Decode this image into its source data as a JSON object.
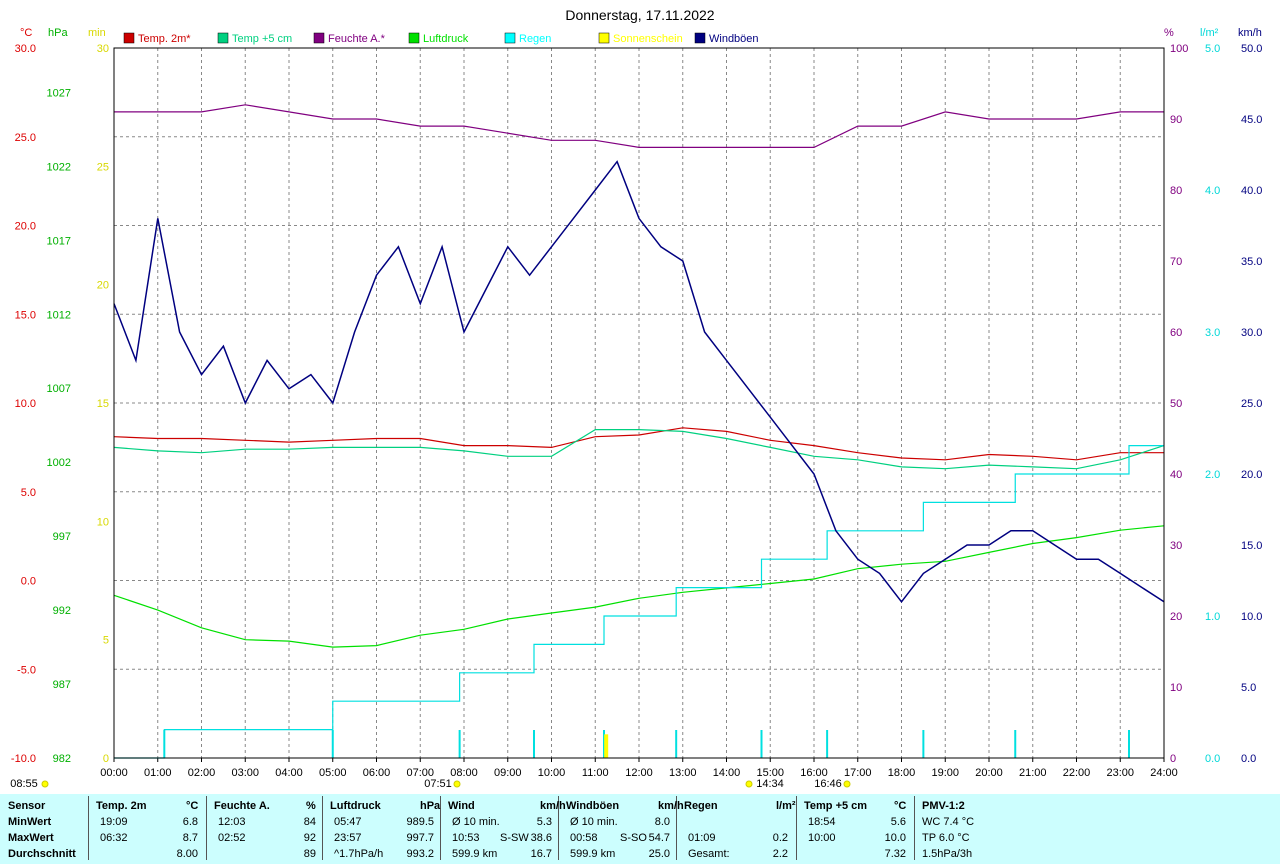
{
  "chart_data": {
    "type": "line",
    "title": "Donnerstag, 17.11.2022",
    "x_ticks": [
      "00:00",
      "01:00",
      "02:00",
      "03:00",
      "04:00",
      "05:00",
      "06:00",
      "07:00",
      "08:00",
      "09:00",
      "10:00",
      "11:00",
      "12:00",
      "13:00",
      "14:00",
      "15:00",
      "16:00",
      "17:00",
      "18:00",
      "19:00",
      "20:00",
      "21:00",
      "22:00",
      "23:00",
      "24:00"
    ],
    "sun_labels": {
      "sunrise": "07:51",
      "solar_noon": "14:34",
      "sunset": "16:46",
      "time_left": "08:55"
    },
    "axes": {
      "temp": {
        "unit": "°C",
        "range": [
          -10,
          30
        ],
        "ticks": [
          "30.0",
          "25.0",
          "20.0",
          "15.0",
          "10.0",
          "5.0",
          "0.0",
          "-5.0",
          "-10.0"
        ],
        "color": "#ff0000"
      },
      "pressure": {
        "unit": "hPa",
        "range": [
          982,
          1030
        ],
        "ticks": [
          "1027",
          "1022",
          "1017",
          "1012",
          "1007",
          "1002",
          "997",
          "992",
          "987",
          "982"
        ],
        "color": "#00c000"
      },
      "sunshine": {
        "unit": "min",
        "range": [
          0,
          30
        ],
        "ticks": [
          "30",
          "25",
          "20",
          "15",
          "10",
          "5",
          "0"
        ],
        "color": "#ffff00"
      },
      "humidity": {
        "unit": "%",
        "range": [
          0,
          100
        ],
        "ticks": [
          "100",
          "90",
          "80",
          "70",
          "60",
          "50",
          "40",
          "30",
          "20",
          "10",
          "0"
        ],
        "color": "#800080"
      },
      "rain": {
        "unit": "l/m²",
        "range": [
          0,
          5
        ],
        "ticks": [
          "5.0",
          "4.0",
          "3.0",
          "2.0",
          "1.0",
          "0.0"
        ],
        "color": "#00ffff"
      },
      "wind": {
        "unit": "km/h",
        "range": [
          0,
          50
        ],
        "ticks": [
          "50.0",
          "45.0",
          "40.0",
          "35.0",
          "30.0",
          "25.0",
          "20.0",
          "15.0",
          "10.0",
          "5.0",
          "0.0"
        ],
        "color": "#000080"
      }
    },
    "legend": [
      {
        "name": "Temp. 2m*",
        "color": "#cc0000"
      },
      {
        "name": "Temp +5 cm",
        "color": "#00d080"
      },
      {
        "name": "Feuchte A.*",
        "color": "#800080"
      },
      {
        "name": "Luftdruck",
        "color": "#00e000"
      },
      {
        "name": "Regen",
        "color": "#00ffff"
      },
      {
        "name": "Sonnenschein",
        "color": "#ffff00"
      },
      {
        "name": "Windböen",
        "color": "#000080"
      }
    ],
    "series": [
      {
        "name": "Temp. 2m*",
        "axis": "temp",
        "x": [
          0,
          1,
          2,
          3,
          4,
          5,
          6,
          7,
          8,
          9,
          10,
          11,
          12,
          13,
          14,
          15,
          16,
          17,
          18,
          19,
          20,
          21,
          22,
          23,
          24
        ],
        "y": [
          8.1,
          8.0,
          8.0,
          7.9,
          7.8,
          7.9,
          8.0,
          8.0,
          7.6,
          7.6,
          7.5,
          8.1,
          8.2,
          8.6,
          8.4,
          7.9,
          7.6,
          7.2,
          6.9,
          6.8,
          7.1,
          7.0,
          6.8,
          7.2,
          7.2
        ]
      },
      {
        "name": "Temp +5 cm",
        "axis": "temp",
        "x": [
          0,
          1,
          2,
          3,
          4,
          5,
          6,
          7,
          8,
          9,
          10,
          11,
          12,
          13,
          14,
          15,
          16,
          17,
          18,
          19,
          20,
          21,
          22,
          23,
          24
        ],
        "y": [
          7.5,
          7.3,
          7.2,
          7.4,
          7.4,
          7.5,
          7.5,
          7.5,
          7.3,
          7.0,
          7.0,
          8.5,
          8.5,
          8.4,
          8.0,
          7.5,
          7.0,
          6.8,
          6.4,
          6.3,
          6.5,
          6.4,
          6.3,
          6.8,
          7.6
        ]
      },
      {
        "name": "Feuchte A.*",
        "axis": "humidity",
        "x": [
          0,
          1,
          2,
          3,
          4,
          5,
          6,
          7,
          8,
          9,
          10,
          11,
          12,
          13,
          14,
          15,
          16,
          17,
          18,
          19,
          20,
          21,
          22,
          23,
          24
        ],
        "y": [
          91,
          91,
          91,
          92,
          91,
          90,
          90,
          89,
          89,
          88,
          87,
          87,
          86,
          86,
          86,
          86,
          86,
          89,
          89,
          91,
          90,
          90,
          90,
          91,
          91
        ]
      },
      {
        "name": "Luftdruck",
        "axis": "pressure",
        "x": [
          0,
          1,
          2,
          3,
          4,
          5,
          6,
          7,
          8,
          9,
          10,
          11,
          12,
          13,
          14,
          15,
          16,
          17,
          18,
          19,
          20,
          21,
          22,
          23,
          24
        ],
        "y": [
          993.0,
          992.0,
          990.8,
          990.0,
          989.9,
          989.5,
          989.6,
          990.3,
          990.7,
          991.4,
          991.8,
          992.2,
          992.8,
          993.2,
          993.5,
          993.8,
          994.1,
          994.8,
          995.1,
          995.3,
          995.9,
          996.5,
          996.9,
          997.4,
          997.7
        ]
      },
      {
        "name": "Regen",
        "axis": "rain",
        "type": "step",
        "x": [
          0,
          1.15,
          5.0,
          7.9,
          9.6,
          11.2,
          12.85,
          14.8,
          16.3,
          18.5,
          20.6,
          23.2,
          24
        ],
        "y": [
          0.0,
          0.2,
          0.4,
          0.6,
          0.8,
          1.0,
          1.2,
          1.4,
          1.6,
          1.8,
          2.0,
          2.2,
          2.2
        ]
      },
      {
        "name": "Windböen",
        "axis": "wind",
        "x": [
          0,
          0.5,
          1,
          1.5,
          2,
          2.5,
          3,
          3.5,
          4,
          4.5,
          5,
          5.5,
          6,
          6.5,
          7,
          7.5,
          8,
          8.5,
          9,
          9.5,
          10,
          10.5,
          11,
          11.5,
          12,
          12.5,
          13,
          13.5,
          14,
          14.5,
          15,
          15.5,
          16,
          16.5,
          17,
          17.5,
          18,
          18.5,
          19,
          19.5,
          20,
          20.5,
          21,
          21.5,
          22,
          22.5,
          23,
          23.5,
          24
        ],
        "y": [
          32,
          28,
          38,
          30,
          27,
          29,
          25,
          28,
          26,
          27,
          25,
          30,
          34,
          36,
          32,
          36,
          30,
          33,
          36,
          34,
          36,
          38,
          40,
          42,
          38,
          36,
          35,
          30,
          28,
          26,
          24,
          22,
          20,
          16,
          14,
          13,
          11,
          13,
          14,
          15,
          15,
          16,
          16,
          15,
          14,
          14,
          13,
          12,
          11
        ]
      }
    ],
    "sunshine_bars": [
      {
        "time": 11.25,
        "min": 1.0
      }
    ]
  },
  "stats": {
    "headers": [
      {
        "label": "Sensor",
        "unit": ""
      },
      {
        "label": "Temp. 2m",
        "unit": "°C"
      },
      {
        "label": "Feuchte A.",
        "unit": "%"
      },
      {
        "label": "Luftdruck",
        "unit": "hPa"
      },
      {
        "label": "Wind",
        "unit": "km/h"
      },
      {
        "label": "Windböen",
        "unit": "km/h"
      },
      {
        "label": "Regen",
        "unit": "l/m²"
      },
      {
        "label": "Temp +5 cm",
        "unit": "°C"
      },
      {
        "label": "PMV-1:2",
        "unit": ""
      }
    ],
    "row_labels": [
      "MinWert",
      "MaxWert",
      "Durchschnitt"
    ],
    "temp2m": [
      [
        "19:09",
        "6.8"
      ],
      [
        "06:32",
        "8.7"
      ],
      [
        "",
        "8.00"
      ]
    ],
    "feuchte": [
      [
        "12:03",
        "84"
      ],
      [
        "02:52",
        "92"
      ],
      [
        "",
        "89"
      ]
    ],
    "luftdruck": [
      [
        "05:47",
        "989.5"
      ],
      [
        "23:57",
        "997.7"
      ],
      [
        "^1.7hPa/h",
        "993.2"
      ]
    ],
    "wind": [
      [
        "Ø 10 min.",
        "",
        "5.3"
      ],
      [
        "10:53",
        "S-SW",
        "38.6"
      ],
      [
        "599.9 km",
        "",
        "16.7"
      ]
    ],
    "boeen": [
      [
        "Ø 10 min.",
        "",
        "8.0"
      ],
      [
        "00:58",
        "S-SO",
        "54.7"
      ],
      [
        "599.9 km",
        "",
        "25.0"
      ]
    ],
    "regen": [
      [
        "",
        ""
      ],
      [
        "01:09",
        "0.2"
      ],
      [
        "Gesamt:",
        "2.2"
      ]
    ],
    "temp5": [
      [
        "18:54",
        "5.6"
      ],
      [
        "10:00",
        "10.0"
      ],
      [
        "",
        "7.32"
      ]
    ],
    "pmv": [
      "WC 7.4 °C",
      "TP 6.0 °C",
      "1.5hPa/3h"
    ]
  }
}
